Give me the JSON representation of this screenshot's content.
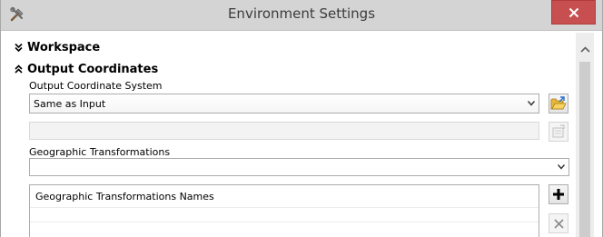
{
  "window": {
    "title": "Environment Settings"
  },
  "sections": {
    "workspace": "Workspace",
    "output_coordinates": "Output Coordinates"
  },
  "output_coordinates": {
    "system_label": "Output Coordinate System",
    "system_value": "Same as Input",
    "transformations_label": "Geographic Transformations",
    "transformations_value": ""
  },
  "transformations_table": {
    "column_header": "Geographic Transformations Names",
    "rows": [
      "",
      ""
    ]
  },
  "colors": {
    "titlebar": "#d4d4d4",
    "close_button": "#c74f4f",
    "content_background": "#ffffff",
    "window_background": "#f0f0f0"
  },
  "icons": {
    "app": "tools-icon",
    "close": "close-icon",
    "workspace_toggle": "chevron-double-down-icon",
    "output_coordinates_toggle": "chevron-double-up-icon",
    "browse": "folder-open-icon",
    "properties": "properties-icon",
    "add": "plus-icon",
    "remove": "x-icon",
    "scroll_up": "chevron-up-icon"
  }
}
